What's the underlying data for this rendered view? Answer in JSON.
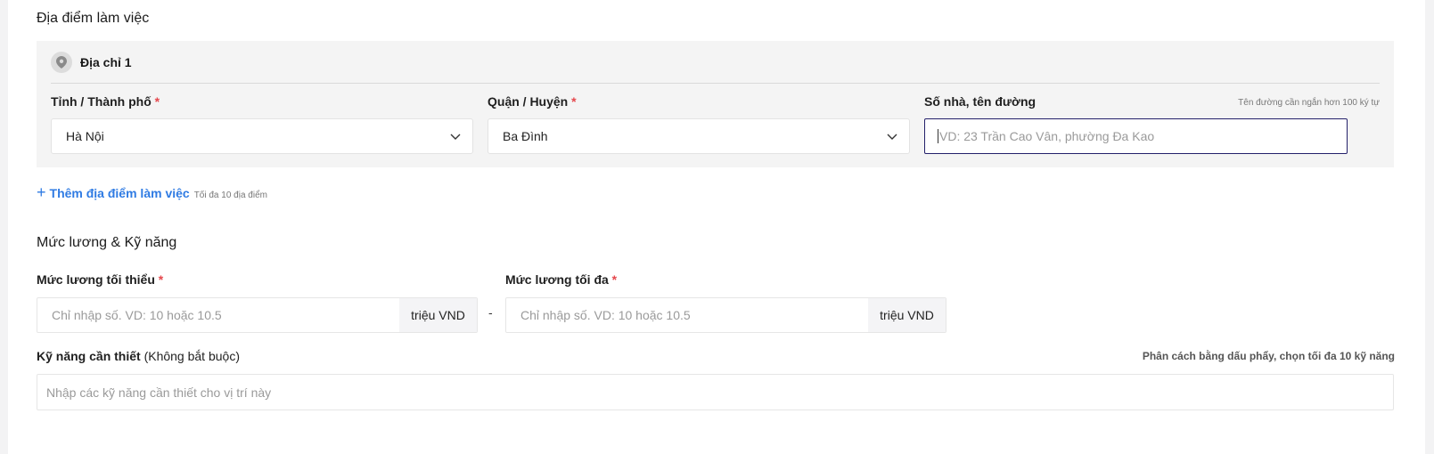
{
  "work_location": {
    "section_title": "Địa điểm làm việc",
    "address": {
      "title": "Địa chỉ 1",
      "province_label": "Tỉnh / Thành phố",
      "province_value": "Hà Nội",
      "district_label": "Quận / Huyện",
      "district_value": "Ba Đình",
      "street_label": "Số nhà, tên đường",
      "street_hint": "Tên đường cần ngắn hơn 100 ký tự",
      "street_placeholder": "VD: 23 Trần Cao Vân, phường Đa Kao"
    },
    "required_mark": "*",
    "add_label": "Thêm địa điểm làm việc",
    "add_hint": "Tối đa 10 địa điểm"
  },
  "salary_skills": {
    "section_title": "Mức lương & Kỹ năng",
    "min_label": "Mức lương tối thiểu",
    "max_label": "Mức lương tối đa",
    "placeholder": "Chỉ nhập số. VD: 10 hoặc 10.5",
    "unit": "triệu VND",
    "separator": "-",
    "skills_label": "Kỹ năng cần thiết",
    "skills_optional": "(Không bắt buộc)",
    "skills_hint": "Phân cách bằng dấu phẩy, chọn tối đa 10 kỹ năng",
    "skills_placeholder": "Nhập các kỹ năng cần thiết cho vị trí này"
  },
  "colors": {
    "accent_link": "#2f7be3",
    "required": "#e5484d",
    "focus_border": "#24206a"
  },
  "icons": [
    "location-pin-icon",
    "chevron-down-icon",
    "plus-icon"
  ]
}
